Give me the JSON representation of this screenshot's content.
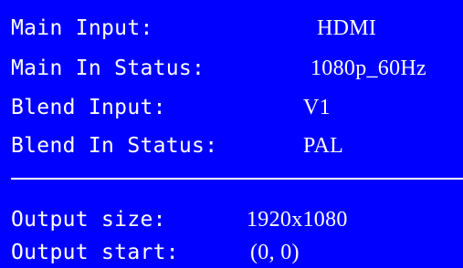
{
  "screen": {
    "background_color": "#0000ff",
    "text_color": "#ffffff"
  },
  "status": [
    {
      "label": "Main Input:",
      "value": "HDMI"
    },
    {
      "label": "Main In Status:",
      "value": "1080p_60Hz"
    },
    {
      "label": "Blend Input:",
      "value": "V1"
    },
    {
      "label": "Blend In Status:",
      "value": "PAL"
    }
  ],
  "output": [
    {
      "label": "Output size:",
      "value": "1920x1080"
    },
    {
      "label": "Output start:",
      "value": "(0, 0)"
    }
  ]
}
